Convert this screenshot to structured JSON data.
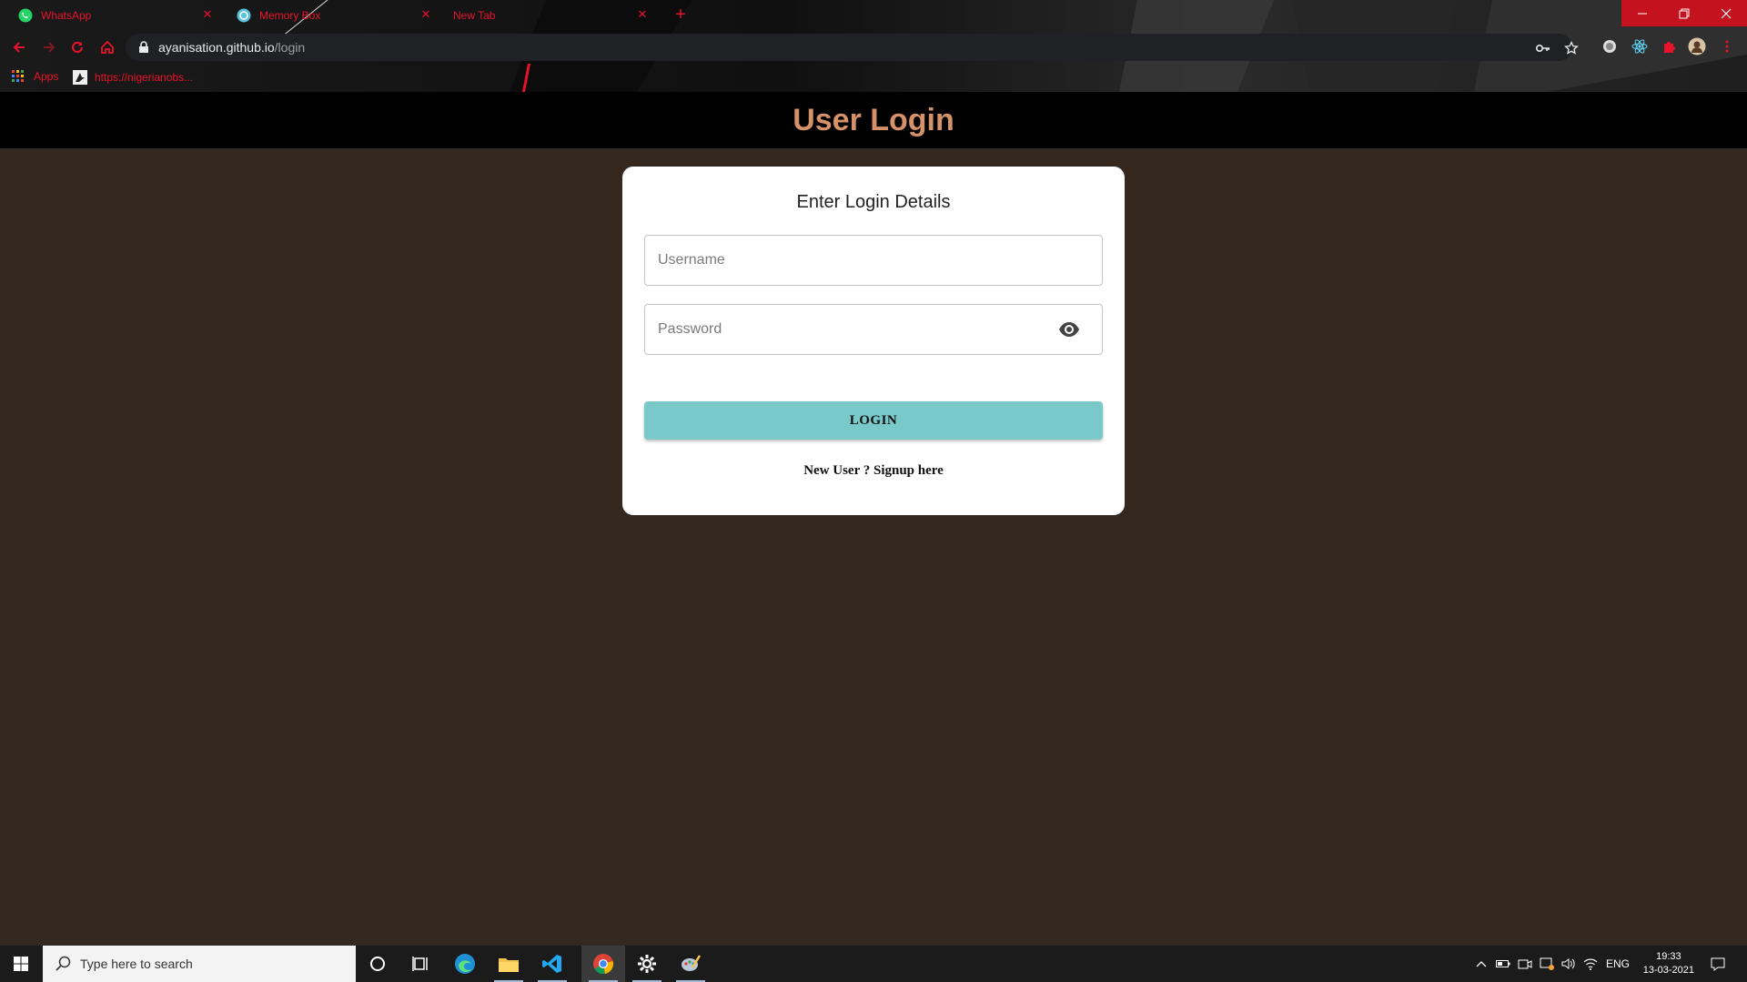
{
  "browser": {
    "tabs": [
      {
        "title": "WhatsApp",
        "icon": "whatsapp-icon"
      },
      {
        "title": "Memory Box",
        "icon": "memory-box-icon"
      },
      {
        "title": "New Tab",
        "icon": ""
      }
    ],
    "address": {
      "host": "ayanisation.github.io",
      "path": "/login"
    },
    "bookmarks": [
      {
        "label": "Apps",
        "icon": "apps-grid-icon"
      },
      {
        "label": "https://nigerianobs...",
        "icon": "bookmark-favicon-icon"
      }
    ],
    "accent_color": "#e8132a"
  },
  "page": {
    "header_title": "User Login",
    "title_color": "#d4916a",
    "background_color": "#35281f",
    "card": {
      "title": "Enter Login Details",
      "username_placeholder": "Username",
      "password_placeholder": "Password",
      "login_label": "LOGIN",
      "login_color": "#7ac9c9",
      "signup_text": "New User ? Signup here"
    }
  },
  "taskbar": {
    "search_placeholder": "Type here to search",
    "apps": [
      "cortana-icon",
      "task-view-icon",
      "edge-icon",
      "file-explorer-icon",
      "vscode-icon",
      "chrome-icon",
      "settings-icon",
      "paint-icon"
    ],
    "language": "ENG",
    "time": "19:33",
    "date": "13-03-2021"
  }
}
